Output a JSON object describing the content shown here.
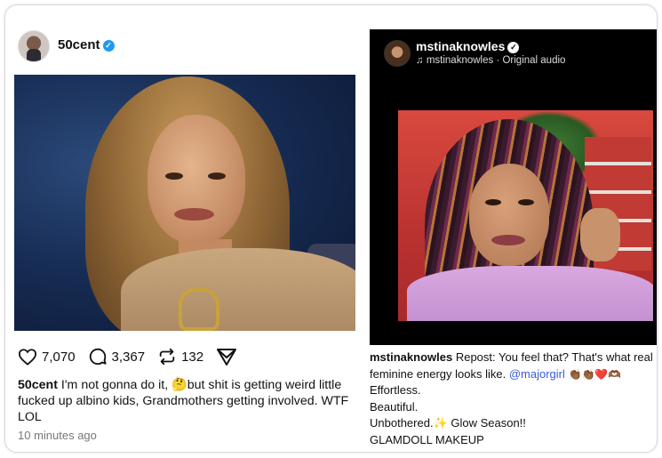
{
  "left_post": {
    "username": "50cent",
    "verified": true,
    "actions": {
      "likes": "7,070",
      "comments": "3,367",
      "reposts": "132"
    },
    "caption_user": "50cent",
    "caption_text": "I'm not gonna do it, 🤔but shit is getting weird little fucked up albino kids, Grandmothers getting involved.  WTF LOL",
    "timestamp": "10 minutes ago"
  },
  "right_post": {
    "username": "mstinaknowles",
    "verified": true,
    "audio_label": "mstinaknowles · Original audio",
    "caption_user": "mstinaknowles",
    "caption_line1": "Repost: You feel that? That's what real feminine energy looks like.",
    "mention": "@majorgirl",
    "emojis": "👏🏾👏🏾❤️🫶🏾",
    "line2": "Effortless.",
    "line3": "Beautiful.",
    "line4_a": "Unbothered.",
    "line4_emoji": "✨",
    "line4_b": " Glow Season!!",
    "line5": " GLAMDOLL MAKEUP"
  },
  "colors": {
    "verified_blue": "#1d9bf0",
    "mention_blue": "#3a5bd9"
  }
}
